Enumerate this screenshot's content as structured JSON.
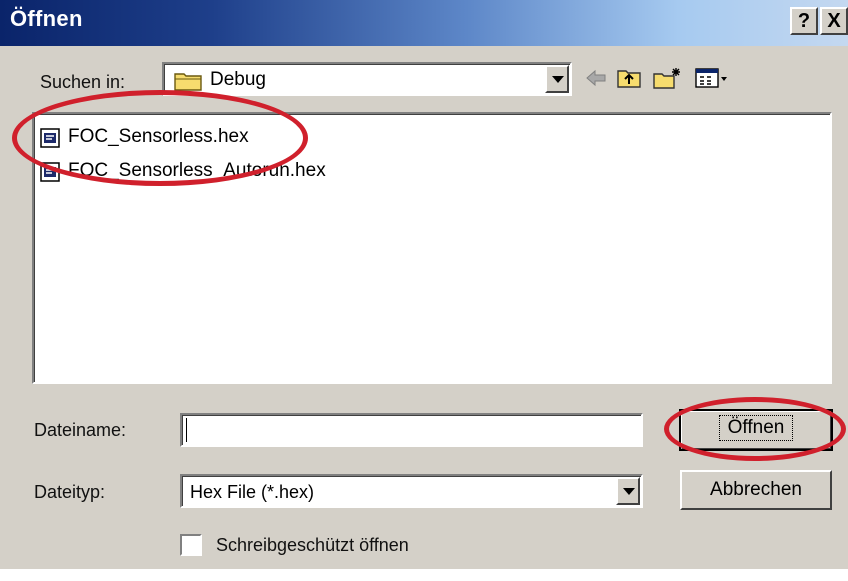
{
  "window": {
    "title": "Öffnen",
    "help_label": "?",
    "close_label": "X"
  },
  "look_in": {
    "label": "Suchen in:",
    "folder": "Debug"
  },
  "toolbar": {
    "icons": [
      "back-arrow-icon",
      "up-folder-icon",
      "new-folder-icon",
      "view-menu-icon"
    ]
  },
  "files": [
    {
      "name": "FOC_Sensorless.hex"
    },
    {
      "name": "FOC_Sensorless_Autorun.hex"
    }
  ],
  "filename": {
    "label": "Dateiname:",
    "value": ""
  },
  "filetype": {
    "label": "Dateityp:",
    "selected": "Hex File (*.hex)"
  },
  "buttons": {
    "open": "Öffnen",
    "cancel": "Abbrechen"
  },
  "readonly": {
    "label": "Schreibgeschützt öffnen",
    "checked": false
  },
  "colors": {
    "annotation": "#d0202c",
    "dialog_bg": "#d4d0c8",
    "title_dark": "#0a246a"
  }
}
